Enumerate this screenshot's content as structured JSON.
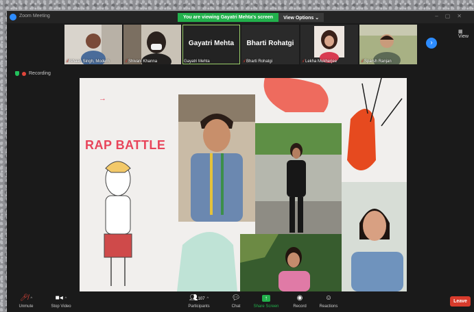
{
  "window": {
    "title": "Zoom Meeting"
  },
  "banner": {
    "text": "You are viewing Gayatri Mehta's screen",
    "button": "View Options ⌄"
  },
  "view_button": "View",
  "participants_strip": [
    {
      "name": "Ishaan Singh, Modern",
      "type": "video"
    },
    {
      "name": "Shivani Khanna",
      "type": "video"
    },
    {
      "name": "Gayatri Mehta",
      "type": "name",
      "display": "Gayatri Mehta",
      "active": true
    },
    {
      "name": "Bharti Rohatgi",
      "type": "name",
      "display": "Bharti Rohatgi"
    },
    {
      "name": "Lekha Mukherjee",
      "type": "video"
    },
    {
      "name": "Sparsh Ranjan",
      "type": "video"
    }
  ],
  "recording": {
    "label": "Recording"
  },
  "shared_screen": {
    "title": "RAP BATTLE",
    "arrow": "→"
  },
  "toolbar": {
    "unmute": "Unmute",
    "stop_video": "Stop Video",
    "participants": "Participants",
    "participants_count": "107",
    "chat": "Chat",
    "share_screen": "Share Screen",
    "record": "Record",
    "reactions": "Reactions",
    "leave": "Leave"
  },
  "colors": {
    "accent": "#2d8cff",
    "banner_green": "#22b14c",
    "leave_red": "#d83b2c",
    "rap_pink": "#e8445a"
  }
}
